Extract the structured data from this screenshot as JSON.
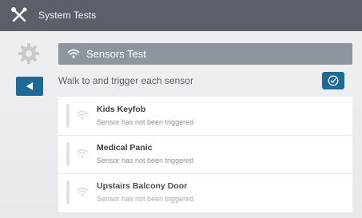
{
  "header": {
    "title": "System Tests"
  },
  "section": {
    "title": "Sensors Test"
  },
  "instruction": "Walk to and trigger each sensor",
  "sensors": [
    {
      "name": "Kids Keyfob",
      "status": "Sensor has not been triggered"
    },
    {
      "name": "Medical Panic",
      "status": "Sensor has not been triggered"
    },
    {
      "name": "Upstairs Balcony Door",
      "status": "Sensor has not been triggered"
    }
  ],
  "colors": {
    "header": "#5b6068",
    "accent": "#1d6a98",
    "section": "#8e959d"
  }
}
